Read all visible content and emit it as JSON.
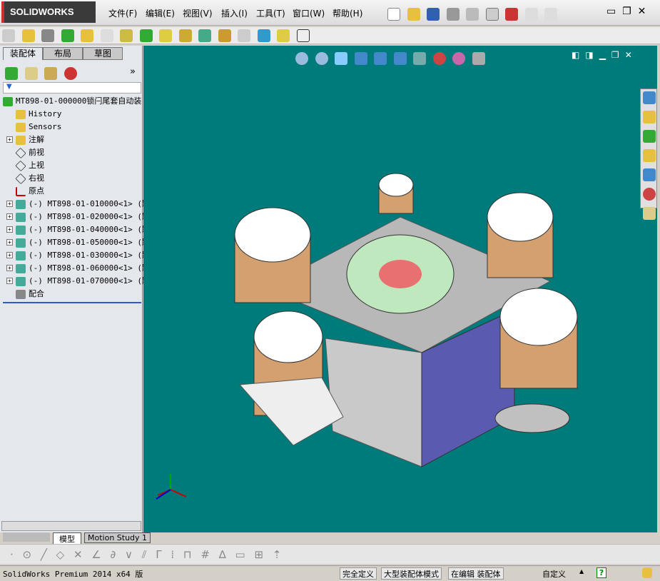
{
  "app": {
    "logo": "SOLIDWORKS"
  },
  "menu": [
    "文件(F)",
    "编辑(E)",
    "视图(V)",
    "插入(I)",
    "工具(T)",
    "窗口(W)",
    "帮助(H)"
  ],
  "panel_tabs": [
    "装配体",
    "布局",
    "草图"
  ],
  "tree": {
    "root": "MT898-01-000000锁闩尾套自动装",
    "items": [
      {
        "label": "History",
        "icon": "history-folder-icon",
        "expand": false
      },
      {
        "label": "Sensors",
        "icon": "sensors-folder-icon",
        "expand": false
      },
      {
        "label": "注解",
        "icon": "annotations-folder-icon",
        "expand": true
      },
      {
        "label": "前视",
        "icon": "plane-icon",
        "expand": false
      },
      {
        "label": "上视",
        "icon": "plane-icon",
        "expand": false
      },
      {
        "label": "右视",
        "icon": "plane-icon",
        "expand": false
      },
      {
        "label": "原点",
        "icon": "origin-icon",
        "expand": false
      },
      {
        "label": "(-) MT898-01-010000<1> (默",
        "icon": "subassembly-icon",
        "expand": true
      },
      {
        "label": "(-) MT898-01-020000<1> (默",
        "icon": "subassembly-icon",
        "expand": true
      },
      {
        "label": "(-) MT898-01-040000<1> (默",
        "icon": "subassembly-icon",
        "expand": true
      },
      {
        "label": "(-) MT898-01-050000<1> (默",
        "icon": "subassembly-icon",
        "expand": true
      },
      {
        "label": "(-) MT898-01-030000<1> (默",
        "icon": "subassembly-icon",
        "expand": true
      },
      {
        "label": "(-) MT898-01-060000<1> (默",
        "icon": "subassembly-icon",
        "expand": true
      },
      {
        "label": "(-) MT898-01-070000<1> (默",
        "icon": "subassembly-icon",
        "expand": true
      },
      {
        "label": "配合",
        "icon": "mates-icon",
        "expand": false
      }
    ]
  },
  "bottom_tabs": [
    "模型",
    "Motion Study 1"
  ],
  "status": {
    "product": "SolidWorks Premium 2014 x64 版",
    "cells": [
      "完全定义",
      "大型装配体模式",
      "在编辑 装配体"
    ],
    "units": "自定义"
  },
  "colors": {
    "viewport": "#007b7b",
    "accent": "#d12b2b"
  }
}
